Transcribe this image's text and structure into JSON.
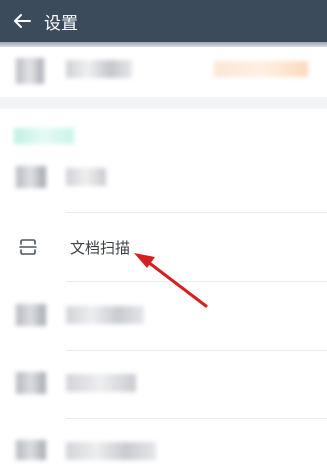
{
  "header": {
    "title": "设置",
    "back_icon": "arrow-left-icon"
  },
  "scan_item": {
    "label": "文档扫描",
    "icon": "document-scan-icon"
  },
  "annotation": {
    "arrow_color": "#d42020"
  }
}
